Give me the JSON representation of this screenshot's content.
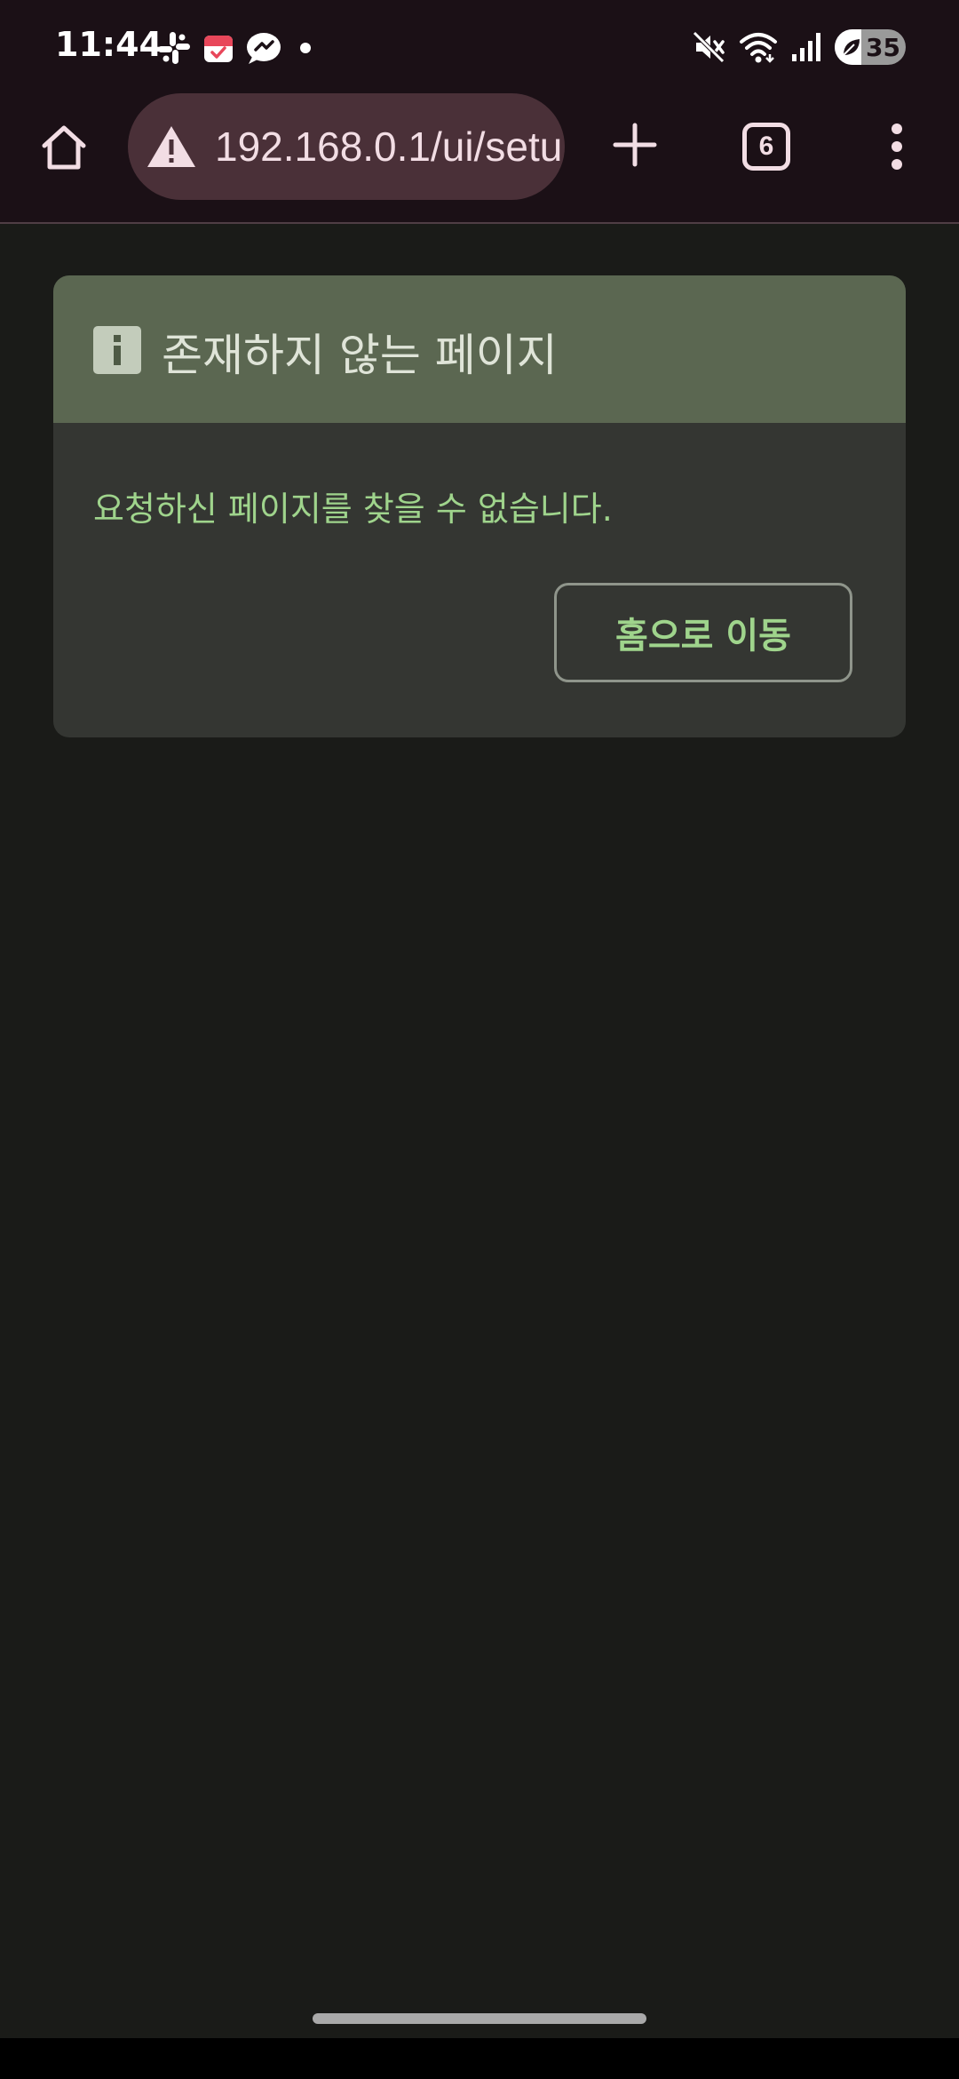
{
  "status_bar": {
    "time": "11:44",
    "battery_level": "35",
    "icons_left": [
      "slack-icon",
      "calendar-icon",
      "messenger-icon",
      "notification-dot-icon"
    ],
    "icons_right": [
      "mute-icon",
      "wifi-icon",
      "signal-icon",
      "battery-icon"
    ]
  },
  "browser": {
    "url": "192.168.0.1/ui/setu",
    "tab_count": "6",
    "icons": [
      "home-icon",
      "warning-icon",
      "plus-icon",
      "tabs-icon",
      "more-vert-icon"
    ]
  },
  "card": {
    "title": "존재하지 않는 페이지",
    "message": "요청하신 페이지를 찾을 수 없습니다.",
    "button_label": "홈으로 이동"
  },
  "colors": {
    "toolbar_bg": "#1b1016",
    "url_pill_bg": "#4a3038",
    "page_bg": "#1a1b18",
    "card_header_bg": "#5b6751",
    "card_body_bg": "#343632",
    "accent_green": "#9fd48c"
  }
}
